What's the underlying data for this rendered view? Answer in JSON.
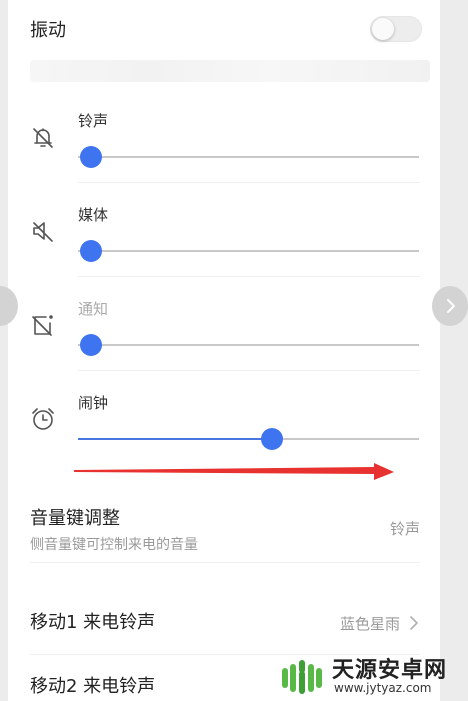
{
  "vibration": {
    "label": "振动",
    "enabled": false
  },
  "volume_sliders": [
    {
      "label": "铃声",
      "icon": "bell-off-icon",
      "level": 0.0,
      "disabled": false
    },
    {
      "label": "媒体",
      "icon": "speaker-mute-icon",
      "level": 0.0,
      "disabled": false
    },
    {
      "label": "通知",
      "icon": "notification-off-icon",
      "level": 0.0,
      "disabled": true
    },
    {
      "label": "闹钟",
      "icon": "alarm-clock-icon",
      "level": 0.57,
      "disabled": false
    }
  ],
  "volume_key": {
    "title": "音量键调整",
    "subtitle": "侧音量键可控制来电的音量",
    "value": "铃声"
  },
  "ringtone_sim1": {
    "title": "移动1 来电铃声",
    "value": "蓝色星雨"
  },
  "ringtone_sim2": {
    "title": "移动2 来电铃声"
  },
  "annotation": {
    "arrow_color": "#e8322f"
  },
  "colors": {
    "accent": "#3f74f0",
    "track": "#c8c8c8"
  },
  "watermark": {
    "name": "天源安卓网",
    "url": "www.jytyaz.com",
    "logo": "android-logo-icon"
  }
}
